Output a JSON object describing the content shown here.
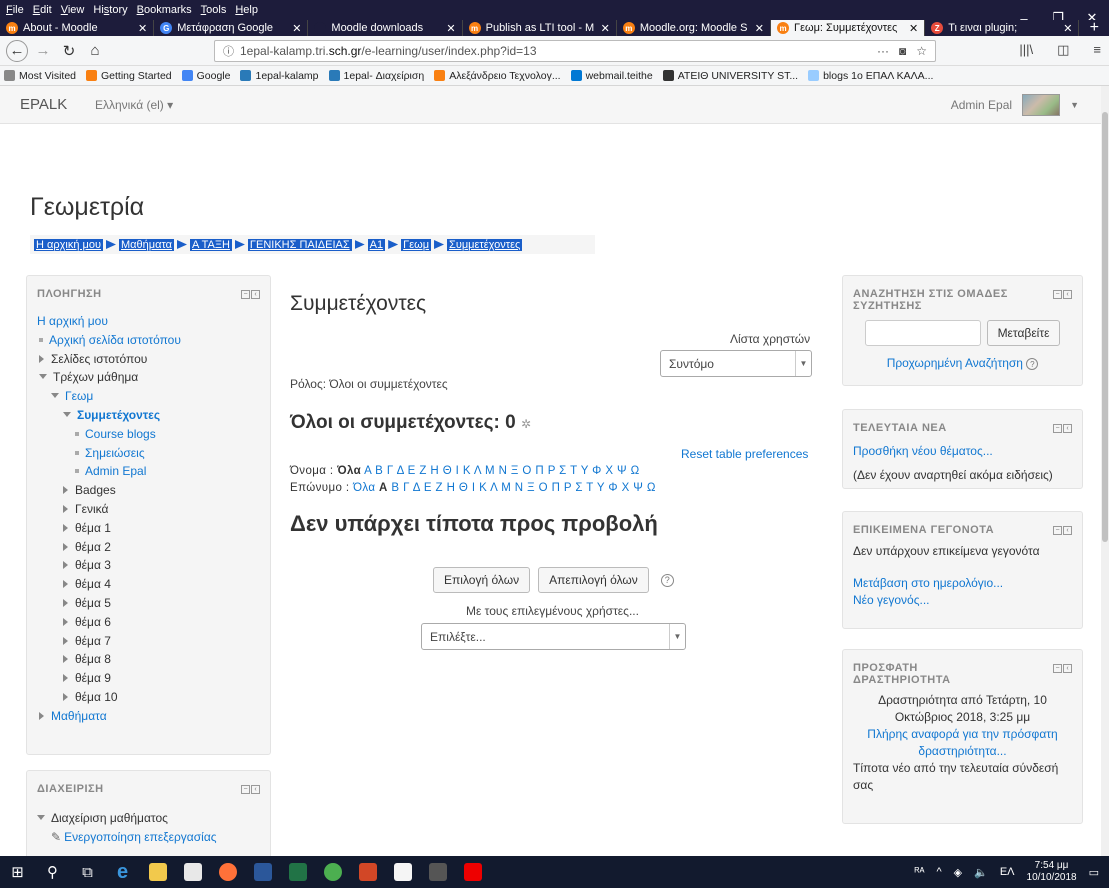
{
  "menubar": {
    "items": [
      "File",
      "Edit",
      "View",
      "History",
      "Bookmarks",
      "Tools",
      "Help"
    ]
  },
  "tabs": [
    {
      "label": "About - Moodle",
      "color": "#f98012",
      "glyph": "m"
    },
    {
      "label": "Μετάφραση Google",
      "color": "#4285f4",
      "glyph": "G"
    },
    {
      "label": "Moodle downloads",
      "color": "#1d1c3b",
      "glyph": ""
    },
    {
      "label": "Publish as LTI tool - M",
      "color": "#f98012",
      "glyph": "m"
    },
    {
      "label": "Moodle.org: Moodle S",
      "color": "#f98012",
      "glyph": "m"
    },
    {
      "label": "Γεωμ: Συμμετέχοντες",
      "color": "#f98012",
      "glyph": "m",
      "active": true
    },
    {
      "label": "Τι ειναι plugin;",
      "color": "#e74c3c",
      "glyph": "Z"
    }
  ],
  "url": {
    "prefix": "1epal-kalamp.tri.",
    "domain": "sch.gr",
    "path": "/e-learning/user/index.php?id=13"
  },
  "bookmarks": [
    "Most Visited",
    "Getting Started",
    "Google",
    "1epal-kalamp",
    "1epal- Διαχείριση",
    "Αλεξάνδρειο Τεχνολογ...",
    "webmail.teithe",
    "ATEIΘ UNIVERSITY ST...",
    "blogs 1ο ΕΠΑΛ ΚΑΛΑ..."
  ],
  "moodle": {
    "brand": "EPALK",
    "language": "Ελληνικά (el) ▾",
    "user": "Admin Epal"
  },
  "course_title": "Γεωμετρία",
  "breadcrumb": [
    "Η αρχική μου",
    "Μαθήματα",
    "Α ΤΑΞΗ",
    "ΓΕΝΙΚΗΣ ΠΑΙΔΕΙΑΣ",
    "Α1",
    "Γεωμ",
    "Συμμετέχοντες"
  ],
  "navigation": {
    "title": "ΠΛΟΗΓΗΣΗ",
    "home": "Η αρχική μου",
    "items": [
      {
        "label": "Αρχική σελίδα ιστοτόπου",
        "type": "bullet",
        "level": 0,
        "link": true
      },
      {
        "label": "Σελίδες ιστοτόπου",
        "type": "right",
        "level": 0
      },
      {
        "label": "Τρέχων μάθημα",
        "type": "down",
        "level": 0
      },
      {
        "label": "Γεωμ",
        "type": "down",
        "level": 1,
        "link": true
      },
      {
        "label": "Συμμετέχοντες",
        "type": "down",
        "level": 2,
        "link": true,
        "bold": true
      },
      {
        "label": "Course blogs",
        "type": "bullet",
        "level": 3,
        "link": true
      },
      {
        "label": "Σημειώσεις",
        "type": "bullet",
        "level": 3,
        "link": true
      },
      {
        "label": "Admin Epal",
        "type": "bullet",
        "level": 3,
        "link": true
      },
      {
        "label": "Badges",
        "type": "right",
        "level": 2
      },
      {
        "label": "Γενικά",
        "type": "right",
        "level": 2
      },
      {
        "label": "θέμα 1",
        "type": "right",
        "level": 2
      },
      {
        "label": "θέμα 2",
        "type": "right",
        "level": 2
      },
      {
        "label": "θέμα 3",
        "type": "right",
        "level": 2
      },
      {
        "label": "θέμα 4",
        "type": "right",
        "level": 2
      },
      {
        "label": "θέμα 5",
        "type": "right",
        "level": 2
      },
      {
        "label": "θέμα 6",
        "type": "right",
        "level": 2
      },
      {
        "label": "θέμα 7",
        "type": "right",
        "level": 2
      },
      {
        "label": "θέμα 8",
        "type": "right",
        "level": 2
      },
      {
        "label": "θέμα 9",
        "type": "right",
        "level": 2
      },
      {
        "label": "θέμα 10",
        "type": "right",
        "level": 2
      },
      {
        "label": "Μαθήματα",
        "type": "right",
        "level": 0,
        "link": true
      }
    ]
  },
  "admin": {
    "title": "ΔΙΑΧΕΙΡΙΣΗ",
    "course_admin": "Διαχείριση μαθήματος",
    "edit_on": "Ενεργοποίηση επεξεργασίας"
  },
  "main": {
    "title": "Συμμετέχοντες",
    "userlist_label": "Λίστα χρηστών",
    "userlist_value": "Συντόμο",
    "role": "Ρόλος: Όλοι οι συμμετέχοντες",
    "all_participants": "Όλοι οι συμμετέχοντες: 0",
    "reset": "Reset table preferences",
    "firstname_label": "Όνομα :",
    "lastname_label": "Επώνυμο :",
    "all": "Όλα",
    "letters": [
      "Α",
      "Β",
      "Γ",
      "Δ",
      "Ε",
      "Ζ",
      "Η",
      "Θ",
      "Ι",
      "Κ",
      "Λ",
      "Μ",
      "Ν",
      "Ξ",
      "Ο",
      "Π",
      "Ρ",
      "Σ",
      "Τ",
      "Υ",
      "Φ",
      "Χ",
      "Ψ",
      "Ω"
    ],
    "nothing": "Δεν υπάρχει τίποτα προς προβολή",
    "select_all": "Επιλογή όλων",
    "deselect_all": "Απεπιλογή όλων",
    "with_selected": "Με τους επιλεγμένους χρήστες...",
    "choose": "Επιλέξτε..."
  },
  "forum_search": {
    "title_line1": "ΑΝΑΖΗΤΗΣΗ ΣΤΙΣ ΟΜΑΔΕΣ",
    "title_line2": "ΣΥΖΗΤΗΣΗΣ",
    "go": "Μεταβείτε",
    "advanced": "Προχωρημένη Αναζήτηση"
  },
  "latest_news": {
    "title": "ΤΕΛΕΥΤΑΙΑ ΝΕΑ",
    "add": "Προσθήκη νέου θέματος...",
    "empty": "(Δεν έχουν αναρτηθεί ακόμα ειδήσεις)"
  },
  "upcoming": {
    "title": "ΕΠΙΚΕΙΜΕΝΑ ΓΕΓΟΝΟΤΑ",
    "empty": "Δεν υπάρχουν επικείμενα γεγονότα",
    "calendar": "Μετάβαση στο ημερολόγιο...",
    "new_event": "Νέο γεγονός..."
  },
  "recent": {
    "title_line1": "ΠΡΟΣΦΑΤΗ",
    "title_line2": "ΔΡΑΣΤΗΡΙΟΤΗΤΑ",
    "since_line1": "Δραστηριότητα από Τετάρτη, 10",
    "since_line2": "Οκτώβριος 2018, 3:25 μμ",
    "report_line1": "Πλήρης αναφορά για την πρόσφατη",
    "report_line2": "δραστηριότητα...",
    "nothing_line1": "Τίποτα νέο από την τελευταία σύνδεσή",
    "nothing_line2": "σας"
  },
  "taskbar": {
    "time": "7:54 μμ",
    "date": "10/10/2018",
    "lang": "ΕΛ"
  }
}
